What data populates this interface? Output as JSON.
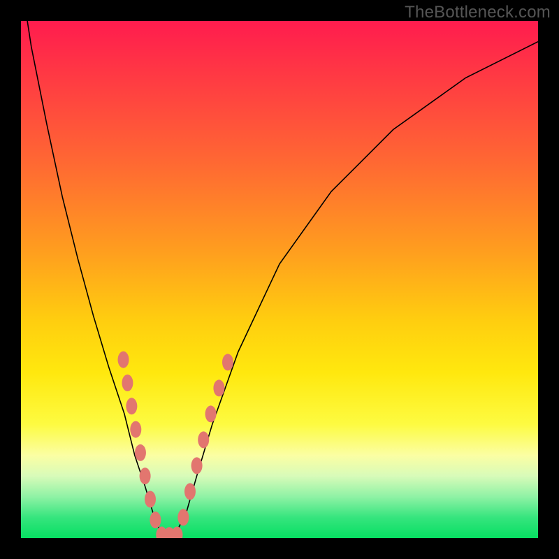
{
  "watermark": "TheBottleneck.com",
  "chart_data": {
    "type": "line",
    "title": "",
    "xlabel": "",
    "ylabel": "",
    "xlim": [
      0,
      100
    ],
    "ylim": [
      0,
      100
    ],
    "grid": false,
    "legend": false,
    "background": "rainbow-vertical-gradient",
    "series": [
      {
        "name": "bottleneck-curve",
        "x": [
          0,
          2,
          5,
          8,
          11,
          14,
          17,
          20,
          22,
          24,
          25.5,
          27,
          28,
          29,
          30,
          32,
          34,
          37,
          42,
          50,
          60,
          72,
          86,
          100
        ],
        "y": [
          108,
          95,
          80,
          66,
          54,
          43,
          33,
          24,
          16,
          10,
          5,
          1,
          0,
          0,
          1,
          5,
          12,
          22,
          36,
          53,
          67,
          79,
          89,
          96
        ]
      }
    ],
    "markers": [
      {
        "name": "left-branch-dots",
        "shape": "ellipse",
        "color": "#e2766f",
        "points": [
          {
            "x": 19.8,
            "y": 34.5
          },
          {
            "x": 20.6,
            "y": 30.0
          },
          {
            "x": 21.4,
            "y": 25.5
          },
          {
            "x": 22.2,
            "y": 21.0
          },
          {
            "x": 23.1,
            "y": 16.5
          },
          {
            "x": 24.0,
            "y": 12.0
          },
          {
            "x": 25.0,
            "y": 7.5
          },
          {
            "x": 26.0,
            "y": 3.5
          }
        ]
      },
      {
        "name": "valley-dots",
        "shape": "ellipse",
        "color": "#e2766f",
        "points": [
          {
            "x": 27.2,
            "y": 0.6
          },
          {
            "x": 28.7,
            "y": 0.5
          },
          {
            "x": 30.2,
            "y": 0.6
          }
        ]
      },
      {
        "name": "right-branch-dots",
        "shape": "ellipse",
        "color": "#e2766f",
        "points": [
          {
            "x": 31.4,
            "y": 4.0
          },
          {
            "x": 32.7,
            "y": 9.0
          },
          {
            "x": 34.0,
            "y": 14.0
          },
          {
            "x": 35.3,
            "y": 19.0
          },
          {
            "x": 36.7,
            "y": 24.0
          },
          {
            "x": 38.3,
            "y": 29.0
          },
          {
            "x": 40.0,
            "y": 34.0
          }
        ]
      }
    ]
  }
}
